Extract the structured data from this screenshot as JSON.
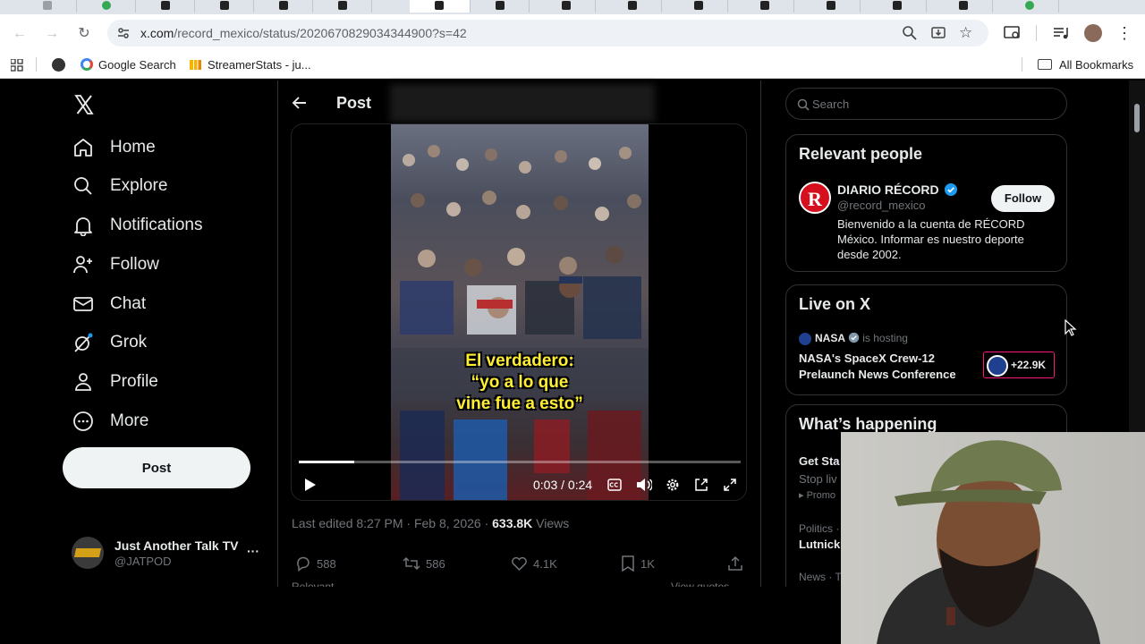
{
  "browser": {
    "url_host": "x.com",
    "url_path": "/record_mexico/status/2020670829034344900?s=42",
    "bookmarks": [
      "Google Search",
      "StreamerStats - ju...",
      "All Bookmarks"
    ]
  },
  "nav": {
    "items": [
      "Home",
      "Explore",
      "Notifications",
      "Follow",
      "Chat",
      "Grok",
      "Profile",
      "More"
    ],
    "post_button": "Post",
    "account": {
      "name": "Just Another Talk TV",
      "handle": "@JATPOD",
      "more": "···"
    }
  },
  "post": {
    "header_title": "Post",
    "video": {
      "caption_line1": "El verdadero:",
      "caption_line2": "“yo a lo que",
      "caption_line3": "vine fue a esto”",
      "time": "0:03 / 0:24",
      "progress": 0.125
    },
    "meta_edited": "Last edited 8:27 PM · Feb 8, 2026 · ",
    "meta_views_count": "633.8K",
    "meta_views_label": " Views",
    "stats": {
      "replies": "588",
      "reposts": "586",
      "likes": "4.1K",
      "bookmarks": "1K"
    },
    "relevant_label": "Relevant",
    "view_quotes": "View quotes"
  },
  "sidebar": {
    "search_placeholder": "Search",
    "relevant_people": {
      "title": "Relevant people",
      "name": "DIARIO RÉCORD",
      "handle": "@record_mexico",
      "bio": "Bienvenido a la cuenta de RÉCORD México. Informar es nuestro deporte desde 2002.",
      "follow": "Follow",
      "avatar_letter": "R"
    },
    "live": {
      "title": "Live on X",
      "host": "NASA",
      "hosting": "is hosting",
      "event": "NASA's SpaceX Crew-12 Prelaunch News Conference",
      "count": "+22.9K"
    },
    "happening": {
      "title": "What’s happening",
      "item1_title": "Get Sta",
      "item1_sub": "Stop liv",
      "item1_promo": "Promo",
      "item2_cat": "Politics ·",
      "item2_title": "Lutnick",
      "item3_cat": "News · Tr"
    }
  },
  "colors": {
    "accent": "#1d9bf0",
    "bg": "#000000",
    "text": "#e7e9ea",
    "muted": "#71767b",
    "live_border": "#f91880"
  }
}
